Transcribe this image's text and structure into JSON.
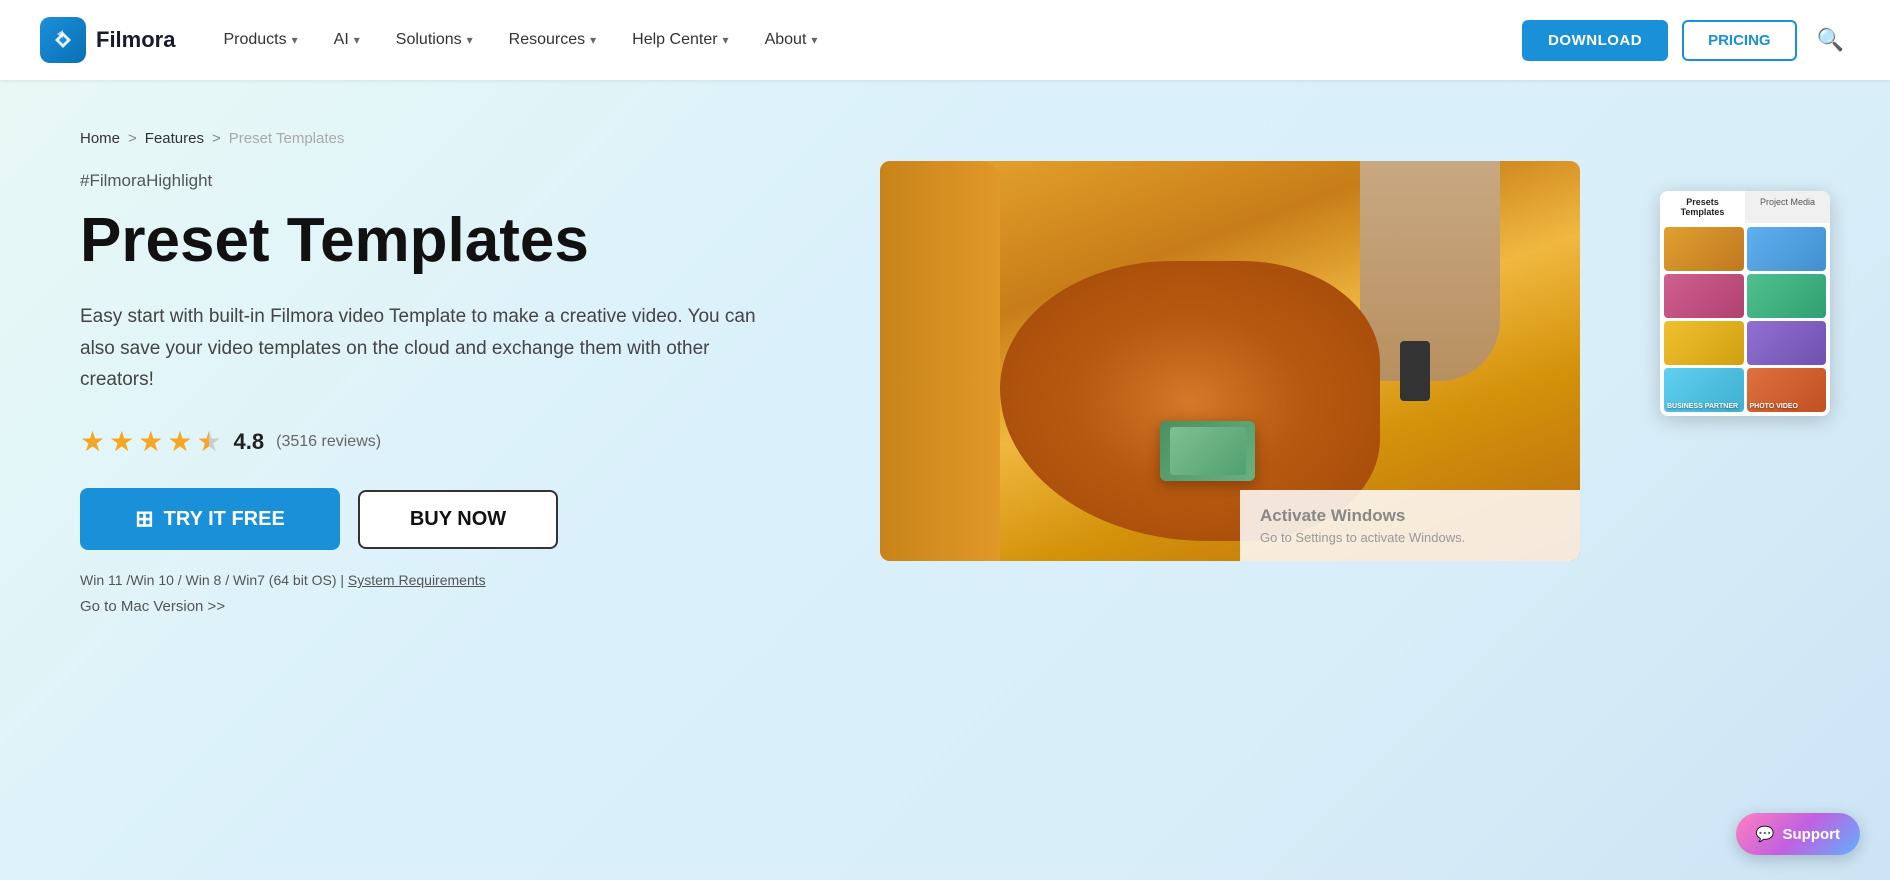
{
  "header": {
    "logo_text": "Filmora",
    "nav_items": [
      {
        "label": "Products",
        "has_dropdown": true
      },
      {
        "label": "AI",
        "has_dropdown": true
      },
      {
        "label": "Solutions",
        "has_dropdown": true
      },
      {
        "label": "Resources",
        "has_dropdown": true
      },
      {
        "label": "Help Center",
        "has_dropdown": true
      },
      {
        "label": "About",
        "has_dropdown": true
      }
    ],
    "btn_download": "DOWNLOAD",
    "btn_pricing": "PRICING"
  },
  "breadcrumb": {
    "home": "Home",
    "sep1": ">",
    "features": "Features",
    "sep2": ">",
    "current": "Preset Templates"
  },
  "hero": {
    "hashtag": "#FilmoraHighlight",
    "title": "Preset Templates",
    "description": "Easy start with built-in Filmora video Template to make a creative video. You can also save your video templates on the cloud and exchange them with other creators!",
    "rating_score": "4.8",
    "rating_count": "(3516 reviews)",
    "btn_try_free": "TRY IT FREE",
    "btn_buy_now": "BUY NOW",
    "sys_req_text": "Win 11 /Win 10 / Win 8 / Win7 (64 bit OS) |",
    "sys_req_link": "System Requirements",
    "mac_version": "Go to Mac Version >>"
  },
  "ui_panel": {
    "tab1": "Presets Templates",
    "tab2": "Project Media",
    "cells": [
      {
        "label": ""
      },
      {
        "label": ""
      },
      {
        "label": ""
      },
      {
        "label": ""
      },
      {
        "label": ""
      },
      {
        "label": ""
      },
      {
        "label": "BUSINESS PARTNER"
      },
      {
        "label": "PHOTO VIDEO"
      }
    ]
  },
  "activate": {
    "title": "Activate Windows",
    "subtitle": "Go to Settings to activate Windows."
  },
  "support": {
    "label": "Support"
  }
}
